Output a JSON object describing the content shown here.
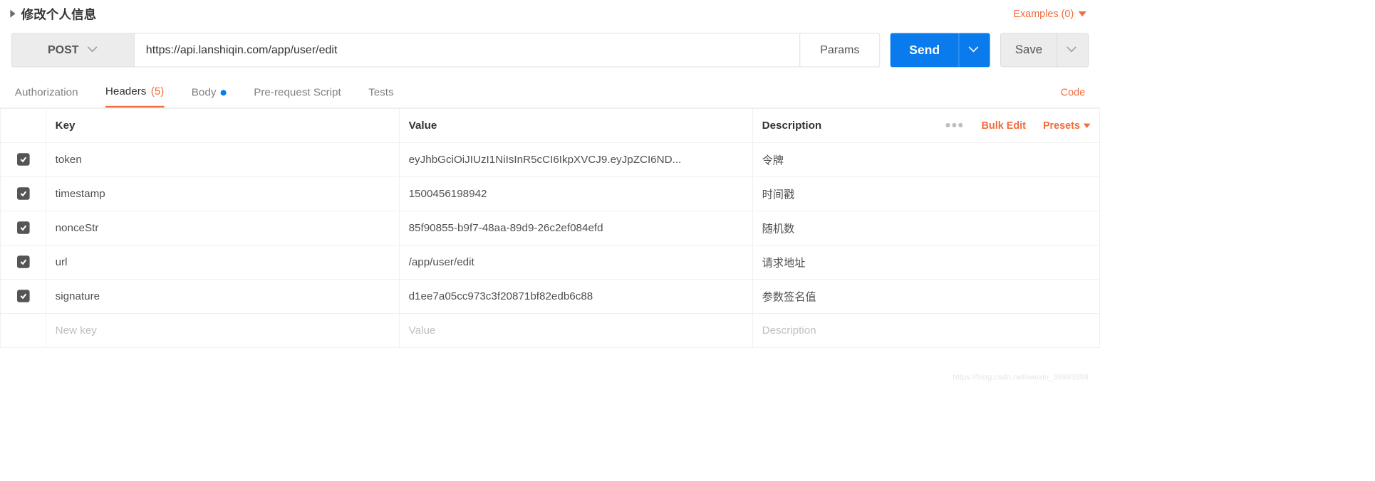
{
  "title": "修改个人信息",
  "examples_label": "Examples (0)",
  "request": {
    "method": "POST",
    "url": "https://api.lanshiqin.com/app/user/edit",
    "params_label": "Params",
    "send_label": "Send",
    "save_label": "Save"
  },
  "tabs": {
    "authorization": "Authorization",
    "headers_label": "Headers",
    "headers_count": "(5)",
    "body": "Body",
    "pre_request": "Pre-request Script",
    "tests": "Tests",
    "code": "Code"
  },
  "columns": {
    "key": "Key",
    "value": "Value",
    "description": "Description"
  },
  "actions": {
    "bulk_edit": "Bulk Edit",
    "presets": "Presets"
  },
  "headers": [
    {
      "enabled": true,
      "key": "token",
      "value": "eyJhbGciOiJIUzI1NiIsInR5cCI6IkpXVCJ9.eyJpZCI6ND...",
      "description": "令牌"
    },
    {
      "enabled": true,
      "key": "timestamp",
      "value": "1500456198942",
      "description": "时间戳"
    },
    {
      "enabled": true,
      "key": "nonceStr",
      "value": "85f90855-b9f7-48aa-89d9-26c2ef084efd",
      "description": "随机数"
    },
    {
      "enabled": true,
      "key": "url",
      "value": "/app/user/edit",
      "description": "请求地址"
    },
    {
      "enabled": true,
      "key": "signature",
      "value": "d1ee7a05cc973c3f20871bf82edb6c88",
      "description": "参数签名值"
    }
  ],
  "new_row": {
    "key_ph": "New key",
    "value_ph": "Value",
    "description_ph": "Description"
  },
  "watermark": "https://blog.csdn.net/weixin_39993899"
}
